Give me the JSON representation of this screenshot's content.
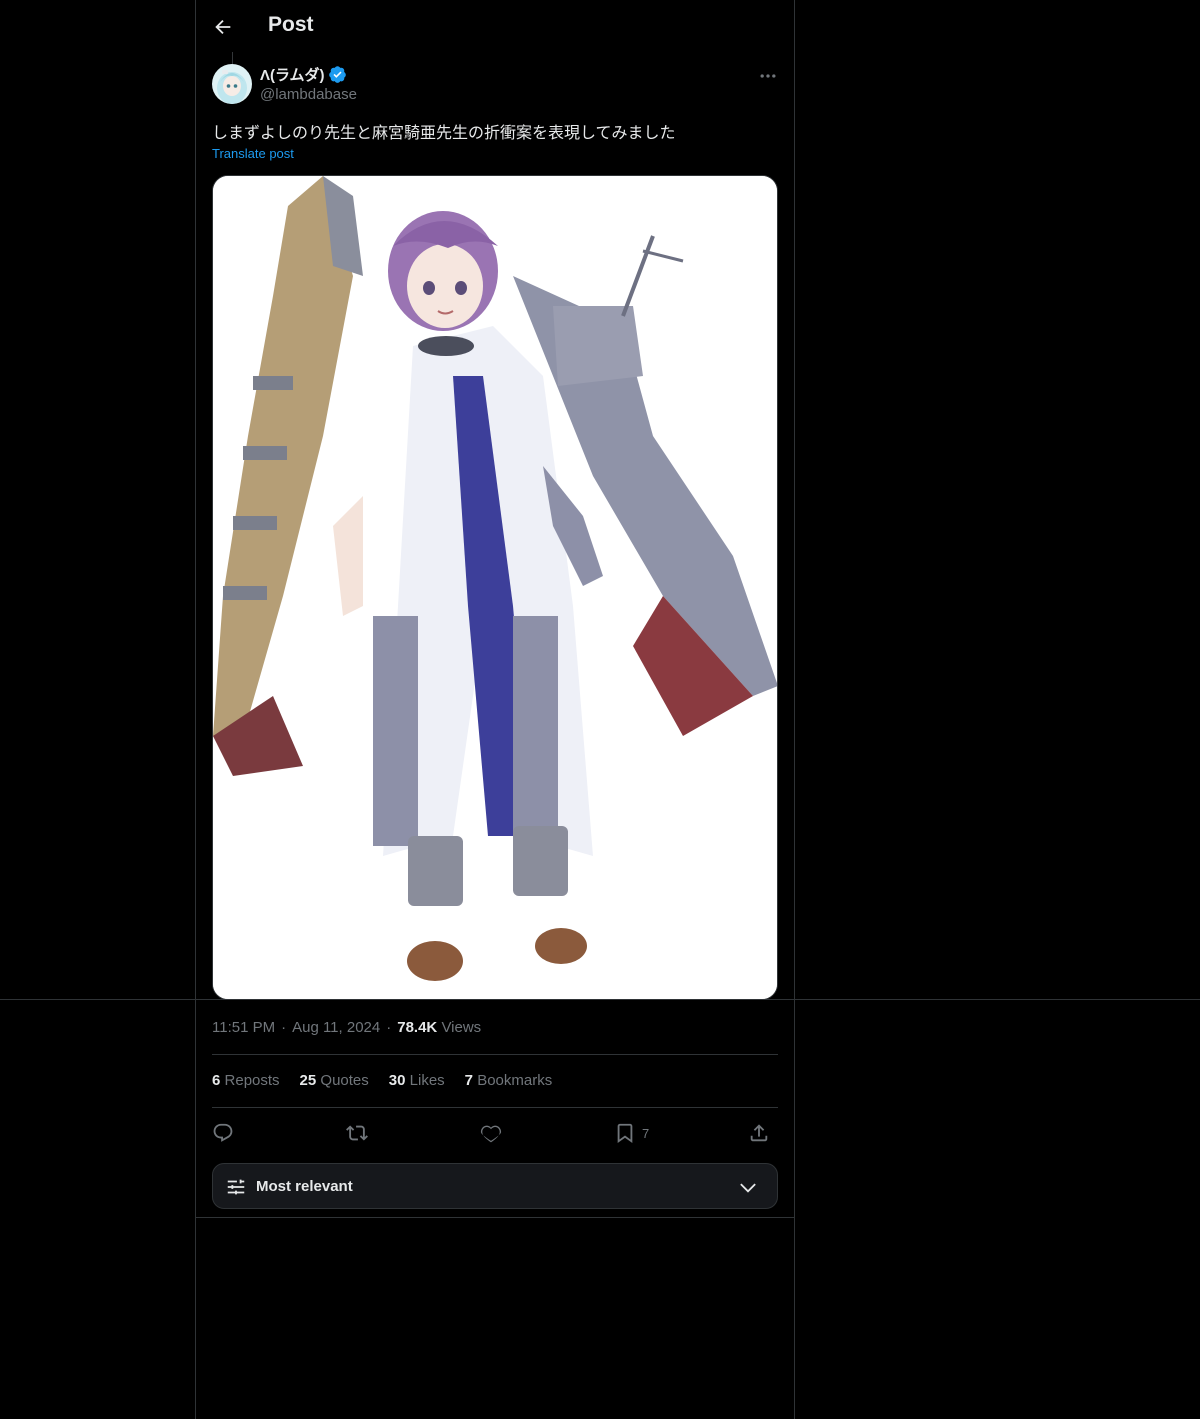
{
  "header": {
    "title": "Post"
  },
  "author": {
    "name": "Λ(ラムダ)",
    "handle": "@lambdabase"
  },
  "post": {
    "text": "しまずよしのり先生と麻宮騎亜先生の折衝案を表現してみました",
    "translate_label": "Translate post",
    "time": "11:51 PM",
    "date": "Aug 11, 2024",
    "views_count": "78.4K",
    "views_label": "Views"
  },
  "stats": {
    "reposts_count": "6",
    "reposts_label": "Reposts",
    "quotes_count": "25",
    "quotes_label": "Quotes",
    "likes_count": "30",
    "likes_label": "Likes",
    "bookmarks_count": "7",
    "bookmarks_label": "Bookmarks"
  },
  "actions": {
    "bookmark_count": "7"
  },
  "sort": {
    "label": "Most relevant"
  },
  "colors": {
    "accent": "#1d9bf0",
    "muted": "#71767b",
    "text": "#e7e9ea",
    "border": "#2f3336"
  }
}
